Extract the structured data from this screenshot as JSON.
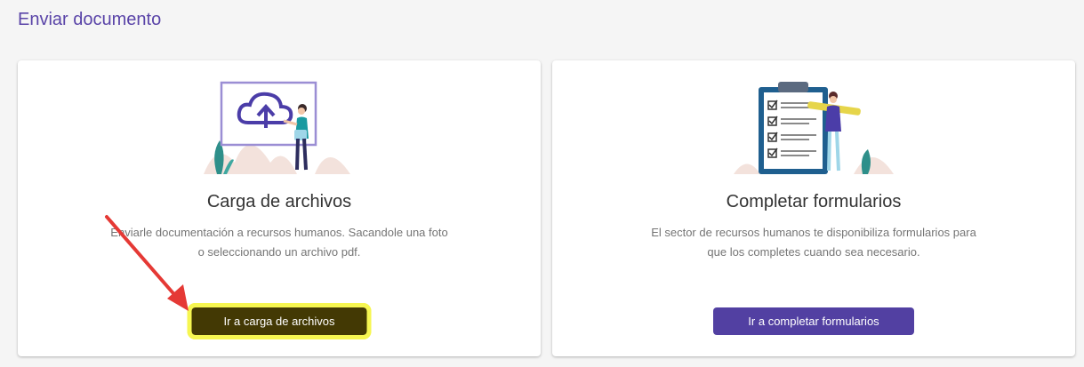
{
  "page": {
    "title": "Enviar documento"
  },
  "cards": [
    {
      "title": "Carga de archivos",
      "description": "Enviarle documentación a recursos humanos. Sacandole una foto o seleccionando un archivo pdf.",
      "button_label": "Ir a carga de archivos",
      "illustration": "cloud-upload-illustration",
      "highlighted": true
    },
    {
      "title": "Completar formularios",
      "description": "El sector de recursos humanos te disponibiliza formularios para que los completes cuando sea necesario.",
      "button_label": "Ir a completar formularios",
      "illustration": "checklist-clipboard-illustration",
      "highlighted": false
    }
  ],
  "colors": {
    "accent": "#5240a2",
    "title": "#5a44a8",
    "highlight": "#f6f651",
    "highlighted_button": "#433904",
    "annotation_arrow": "#e53935"
  }
}
